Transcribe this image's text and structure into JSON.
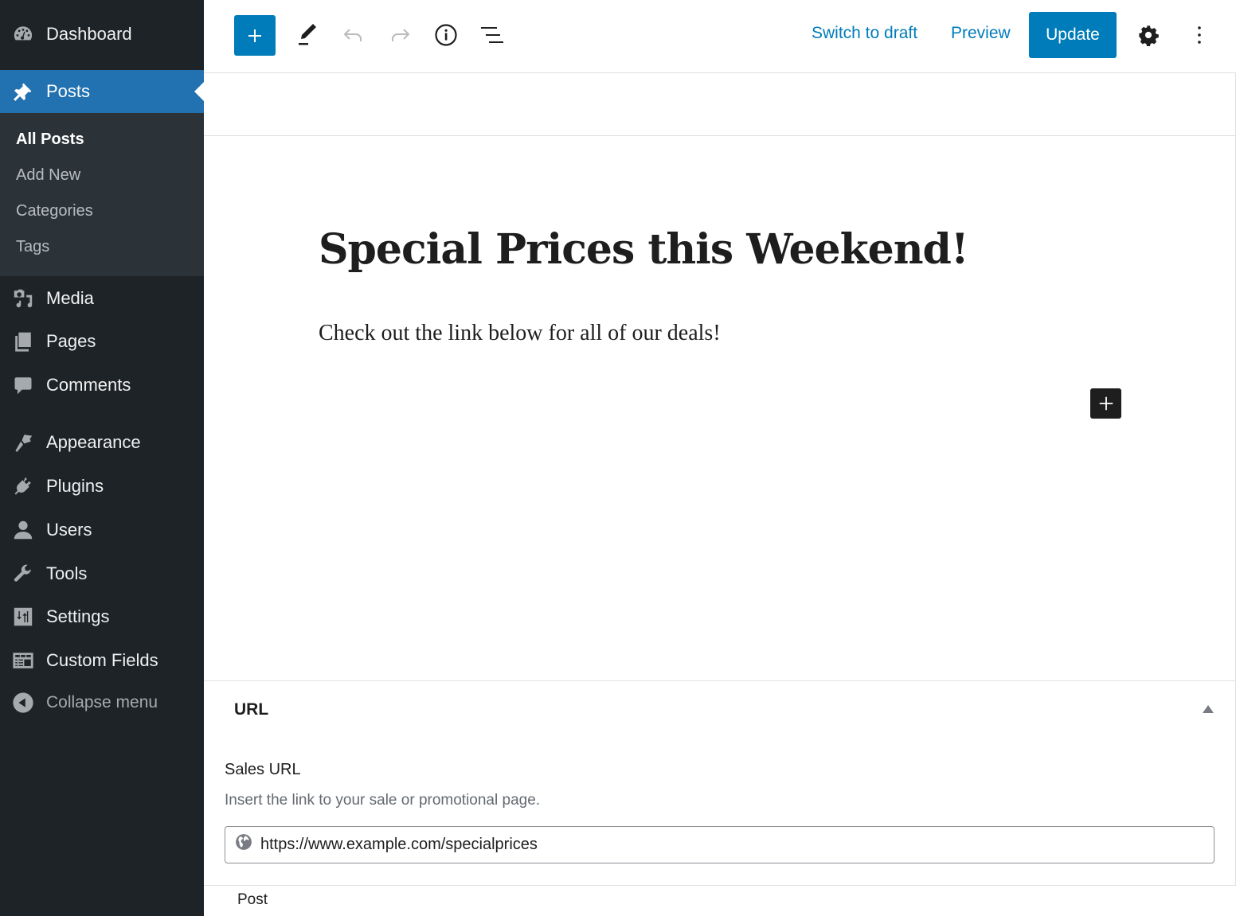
{
  "sidebar": {
    "items": [
      {
        "label": "Dashboard",
        "icon": "dashboard-icon"
      },
      {
        "label": "Posts",
        "icon": "pin-icon",
        "active": true
      },
      {
        "label": "Media",
        "icon": "media-icon"
      },
      {
        "label": "Pages",
        "icon": "pages-icon"
      },
      {
        "label": "Comments",
        "icon": "comment-icon"
      },
      {
        "label": "Appearance",
        "icon": "paintbrush-icon"
      },
      {
        "label": "Plugins",
        "icon": "plugin-icon"
      },
      {
        "label": "Users",
        "icon": "user-icon"
      },
      {
        "label": "Tools",
        "icon": "wrench-icon"
      },
      {
        "label": "Settings",
        "icon": "settings-sliders-icon"
      },
      {
        "label": "Custom Fields",
        "icon": "custom-fields-icon"
      }
    ],
    "submenu": [
      {
        "label": "All Posts",
        "current": true
      },
      {
        "label": "Add New"
      },
      {
        "label": "Categories"
      },
      {
        "label": "Tags"
      }
    ],
    "collapse_label": "Collapse menu"
  },
  "toolbar": {
    "switch_to_draft": "Switch to draft",
    "preview": "Preview",
    "update": "Update",
    "accent_color": "#007cba"
  },
  "editor": {
    "title": "Special Prices this Weekend!",
    "paragraph": "Check out the link below for all of our deals!"
  },
  "metabox": {
    "title": "URL",
    "field_label": "Sales URL",
    "field_description": "Insert the link to your sale or promotional page.",
    "field_value": "https://www.example.com/specialprices"
  },
  "footer": {
    "breadcrumb": "Post"
  }
}
